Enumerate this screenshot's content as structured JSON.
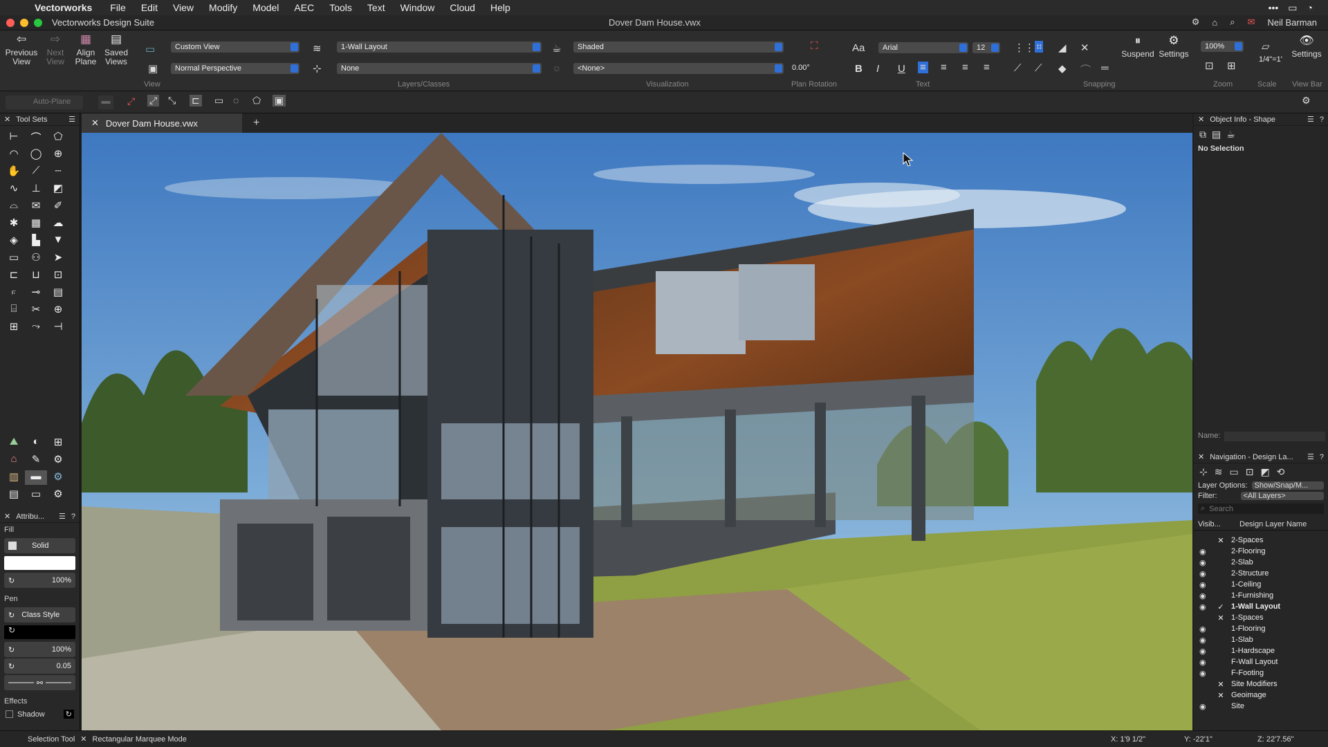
{
  "menubar": {
    "app": "Vectorworks",
    "items": [
      "File",
      "Edit",
      "View",
      "Modify",
      "Model",
      "AEC",
      "Tools",
      "Text",
      "Window",
      "Cloud",
      "Help"
    ]
  },
  "window": {
    "title": "Vectorworks Design Suite",
    "document": "Dover Dam House.vwx",
    "user": "Neil Barman"
  },
  "toolbar": {
    "previous_view": "Previous View",
    "next_view": "Next View",
    "align_plane": "Align Plane",
    "saved_views": "Saved Views",
    "view_dropdown": "Custom View",
    "projection_dropdown": "Normal Perspective",
    "view_group": "View",
    "layer_dropdown": "1-Wall Layout",
    "class_dropdown": "None",
    "layers_group": "Layers/Classes",
    "render_dropdown": "Shaded",
    "light_dropdown": "<None>",
    "visualization_group": "Visualization",
    "plan_rotation_value": "0.00°",
    "plan_rotation_group": "Plan Rotation",
    "font_dropdown": "Arial",
    "size_dropdown": "12",
    "text_group": "Text",
    "snapping_group": "Snapping",
    "suspend": "Suspend",
    "settings": "Settings",
    "zoom_value": "100%",
    "zoom_group": "Zoom",
    "scale_value": "1/4\"=1'",
    "scale_group": "Scale",
    "viewbar_settings": "Settings",
    "viewbar_group": "View Bar"
  },
  "secondary_bar": {
    "auto_plane": "Auto-Plane"
  },
  "left_panel": {
    "tool_sets_title": "Tool Sets",
    "attributes_title": "Attribu...",
    "fill_label": "Fill",
    "fill_type": "Solid",
    "fill_opacity": "100%",
    "pen_label": "Pen",
    "pen_style": "Class Style",
    "pen_opacity": "100%",
    "pen_weight": "0.05",
    "effects_label": "Effects",
    "shadow_label": "Shadow"
  },
  "canvas": {
    "tab_label": "Dover Dam House.vwx"
  },
  "object_info": {
    "title": "Object Info - Shape",
    "selection": "No Selection",
    "name_label": "Name:"
  },
  "navigation": {
    "title": "Navigation - Design La...",
    "layer_options_label": "Layer Options:",
    "layer_options_value": "Show/Snap/M...",
    "filter_label": "Filter:",
    "filter_value": "<All Layers>",
    "search_placeholder": "Search",
    "col_visibility": "Visib...",
    "col_name": "Design Layer Name",
    "layers": [
      {
        "name": "2-Spaces",
        "vis": "x",
        "active": false
      },
      {
        "name": "2-Flooring",
        "vis": "eye",
        "active": false
      },
      {
        "name": "2-Slab",
        "vis": "eye",
        "active": false
      },
      {
        "name": "2-Structure",
        "vis": "eye",
        "active": false
      },
      {
        "name": "1-Ceiling",
        "vis": "eye",
        "active": false
      },
      {
        "name": "1-Furnishing",
        "vis": "eye",
        "active": false
      },
      {
        "name": "1-Wall Layout",
        "vis": "eye",
        "active": true
      },
      {
        "name": "1-Spaces",
        "vis": "x",
        "active": false
      },
      {
        "name": "1-Flooring",
        "vis": "eye",
        "active": false
      },
      {
        "name": "1-Slab",
        "vis": "eye",
        "active": false
      },
      {
        "name": "1-Hardscape",
        "vis": "eye",
        "active": false
      },
      {
        "name": "F-Wall Layout",
        "vis": "eye",
        "active": false
      },
      {
        "name": "F-Footing",
        "vis": "eye",
        "active": false
      },
      {
        "name": "Site Modifiers",
        "vis": "x",
        "active": false
      },
      {
        "name": "Geoimage",
        "vis": "x",
        "active": false
      },
      {
        "name": "Site",
        "vis": "eye",
        "active": false
      }
    ]
  },
  "statusbar": {
    "tool": "Selection Tool",
    "mode": "Rectangular Marquee Mode",
    "x": "X: 1'9 1/2\"",
    "y": "Y: -22'1\"",
    "z": "Z: 22'7.56\""
  }
}
